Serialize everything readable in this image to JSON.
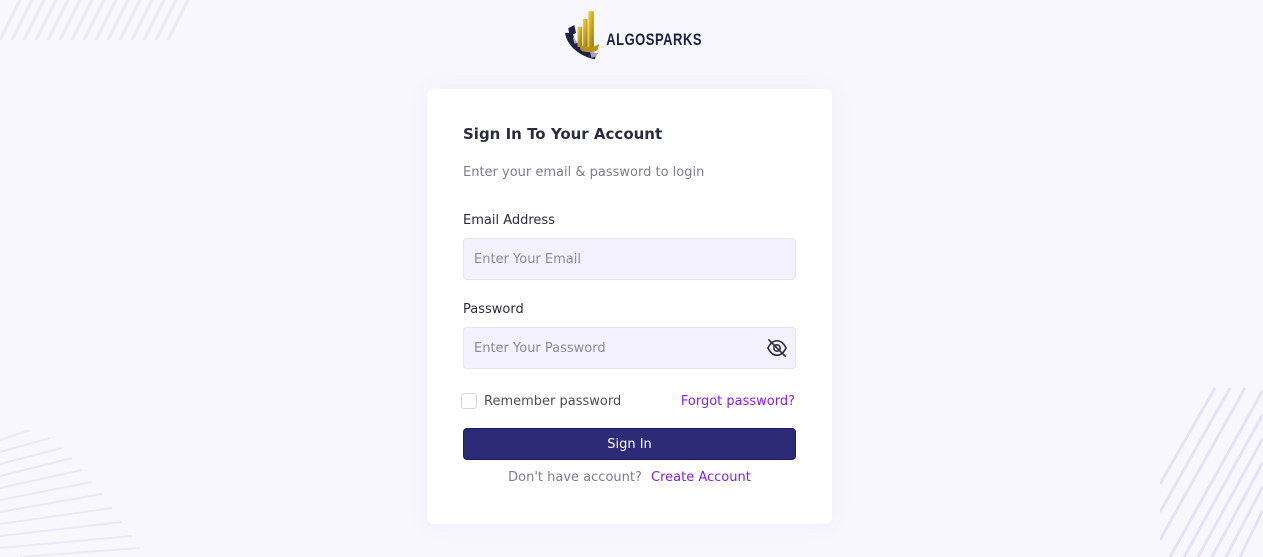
{
  "brand": {
    "name": "ALGOSPARKS",
    "accent_color": "#8a1ee0",
    "button_color": "#2d2a78"
  },
  "login": {
    "title": "Sign In To Your Account",
    "subtitle": "Enter your email & password to login",
    "email_label": "Email Address",
    "email_placeholder": "Enter Your Email",
    "email_value": "",
    "password_label": "Password",
    "password_placeholder": "Enter Your Password",
    "password_value": "",
    "password_toggle_icon": "eye-off-icon",
    "remember_label": "Remember password",
    "remember_checked": false,
    "forgot_label": "Forgot password?",
    "signin_label": "Sign In",
    "no_account_text": "Don't have account?",
    "create_account_label": "Create Account"
  }
}
